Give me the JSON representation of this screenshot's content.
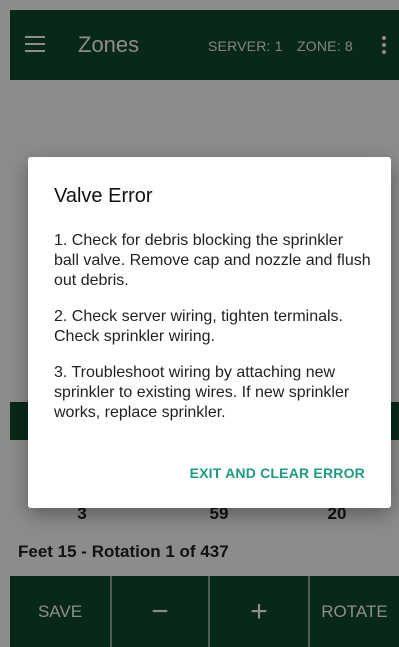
{
  "appbar": {
    "title": "Zones",
    "server_label": "SERVER: 1",
    "zone_label": "ZONE: 8"
  },
  "stats": {
    "values": [
      "3",
      "59",
      "20"
    ]
  },
  "feet_rotation": "Feet 15 - Rotation 1 of 437",
  "buttons": {
    "save": "SAVE",
    "minus": "−",
    "plus": "+",
    "rotate": "ROTATE"
  },
  "dialog": {
    "title": "Valve Error",
    "paragraphs": [
      "1. Check for debris blocking the sprinkler ball valve. Remove cap and nozzle and flush out debris.",
      "2. Check server wiring, tighten terminals. Check sprinkler wiring.",
      "3. Troubleshoot wiring by attaching new sprinkler to existing wires. If new sprinkler works, replace sprinkler."
    ],
    "action": "EXIT AND CLEAR ERROR"
  },
  "colors": {
    "primary": "#10492d",
    "accent": "#1d9b80"
  },
  "icons": {
    "menu": "hamburger-menu-icon",
    "more": "more-vertical-icon"
  }
}
